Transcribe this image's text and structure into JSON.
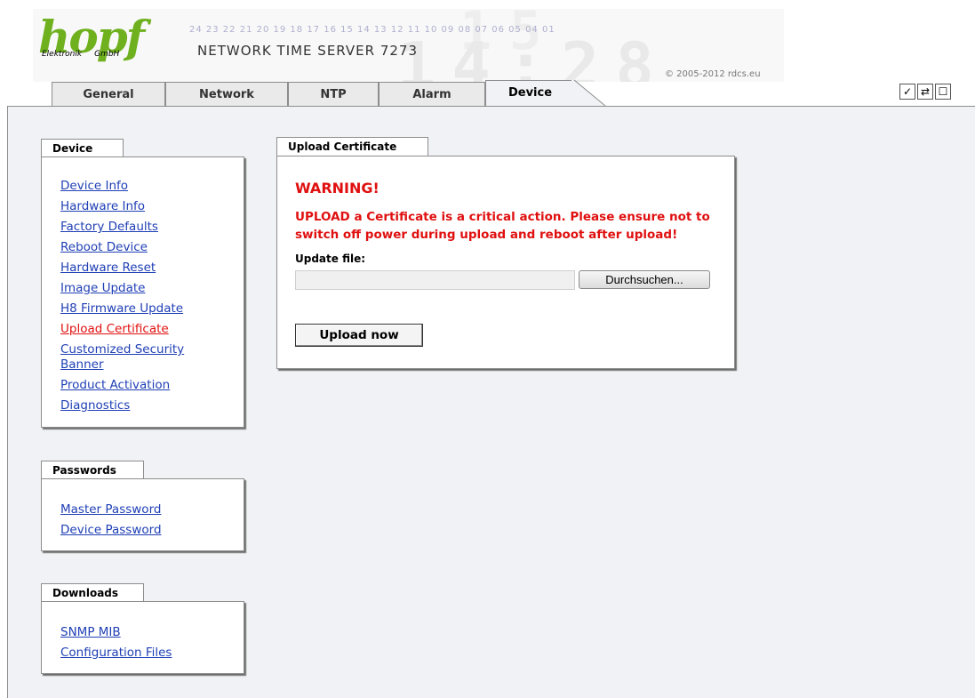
{
  "header": {
    "logo_text": "hopf",
    "logo_sub_left": "Elektronik",
    "logo_sub_right": "GmbH",
    "counter": "24 23 22 21 20 19 18 17 16 15 14 13 12 11 10 09 08 07 06 05 04 01",
    "product_title": "NETWORK TIME SERVER 7273",
    "copyright_prefix": "© 2005-2012 ",
    "copyright_link": "rdcs.eu",
    "bg_digits": "14:28",
    "bg_digits_top": "15"
  },
  "tabs": [
    {
      "label": "General",
      "active": false
    },
    {
      "label": "Network",
      "active": false
    },
    {
      "label": "NTP",
      "active": false
    },
    {
      "label": "Alarm",
      "active": false
    },
    {
      "label": "Device",
      "active": true
    }
  ],
  "toolbar_icons": [
    {
      "name": "apply-icon",
      "glyph": "✓"
    },
    {
      "name": "refresh-icon",
      "glyph": "⇄"
    },
    {
      "name": "window-icon",
      "glyph": "☐"
    }
  ],
  "sidebar": {
    "device": {
      "title": "Device",
      "items": [
        {
          "label": "Device Info",
          "active": false
        },
        {
          "label": "Hardware Info",
          "active": false
        },
        {
          "label": "Factory Defaults",
          "active": false
        },
        {
          "label": "Reboot Device",
          "active": false
        },
        {
          "label": "Hardware Reset",
          "active": false
        },
        {
          "label": "Image Update",
          "active": false
        },
        {
          "label": "H8 Firmware Update",
          "active": false
        },
        {
          "label": "Upload Certificate",
          "active": true
        },
        {
          "label": "Customized Security Banner",
          "active": false
        },
        {
          "label": "Product Activation",
          "active": false
        },
        {
          "label": "Diagnostics",
          "active": false
        }
      ]
    },
    "passwords": {
      "title": "Passwords",
      "items": [
        {
          "label": "Master Password"
        },
        {
          "label": "Device Password"
        }
      ]
    },
    "downloads": {
      "title": "Downloads",
      "items": [
        {
          "label": "SNMP MIB"
        },
        {
          "label": "Configuration Files"
        }
      ]
    }
  },
  "main": {
    "panel_title": "Upload Certificate",
    "warning_title": "WARNING!",
    "warning_text": "UPLOAD a Certificate is a critical action. Please ensure not to switch off power during upload and reboot after upload!",
    "file_label": "Update file:",
    "file_value": "",
    "browse_label": "Durchsuchen...",
    "upload_label": "Upload now"
  },
  "colors": {
    "link": "#1f3fb5",
    "active_link": "#e01010",
    "warning": "#e01010",
    "logo_green": "#6fb01f",
    "content_bg": "#f0f2f5"
  }
}
